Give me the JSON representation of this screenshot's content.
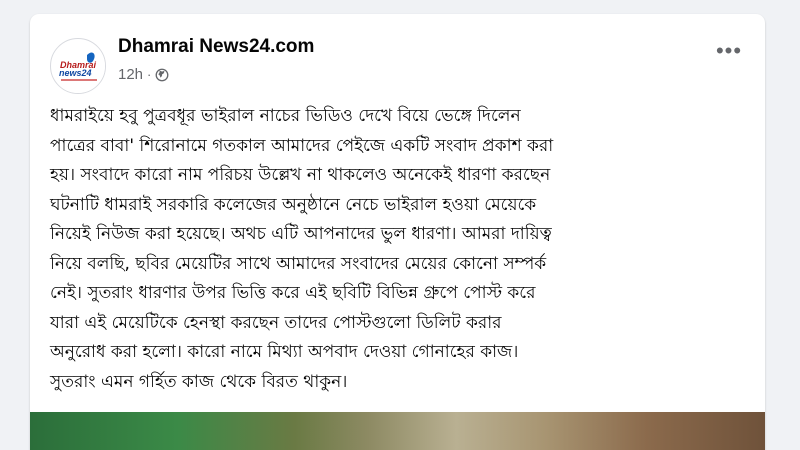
{
  "post": {
    "page_name": "Dhamrai News24.com",
    "time": "12h",
    "separator": "·",
    "audience_icon": "globe-icon",
    "more_icon": "more-horizontal-icon",
    "more_label": "•••",
    "text": "ধামরাইয়ে হবু পুত্রবধূর ভাইরাল নাচের ভিডিও দেখে বিয়ে ভেঙ্গে দিলেন\nপাত্রের বাবা' শিরোনামে গতকাল আমাদের পেইজে একটি সংবাদ প্রকাশ করা\nহয়। সংবাদে কারো নাম পরিচয় উল্লেখ না থাকলেও অনেকেই ধারণা করছেন\nঘটনাটি ধামরাই সরকারি কলেজের অনুষ্ঠানে নেচে ভাইরাল হওয়া মেয়েকে\nনিয়েই নিউজ করা হয়েছে। অথচ এটি আপনাদের ভুল ধারণা। আমরা দায়িত্ব\nনিয়ে বলছি, ছবির মেয়েটির সাথে আমাদের সংবাদের মেয়ের কোনো সম্পর্ক\nনেই। সুতরাং ধারণার উপর ভিত্তি করে এই ছবিটি বিভিন্ন গ্রুপে পোস্ট করে\nযারা এই মেয়েটিকে হেনস্থা করছেন তাদের পোস্টগুলো ডিলিট করার\nঅনুরোধ করা হলো।  কারো নামে মিথ্যা অপবাদ দেওয়া গোনাহের কাজ।\nসুতরাং এমন গর্হিত কাজ থেকে বিরত থাকুন।"
  },
  "colors": {
    "background": "#f0f2f5",
    "card": "#ffffff",
    "text": "#050505",
    "secondary_text": "#65676b"
  }
}
